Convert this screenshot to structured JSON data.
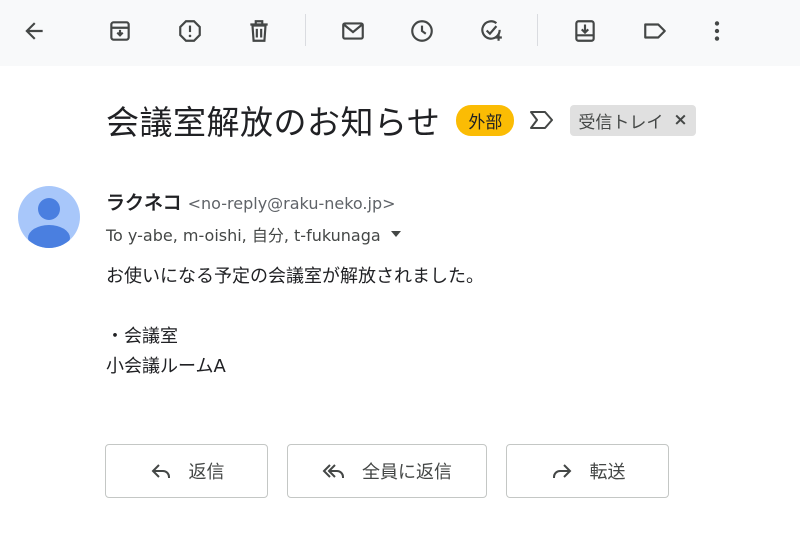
{
  "toolbar": {
    "icons": [
      "back-icon",
      "archive-icon",
      "report-spam-icon",
      "delete-icon",
      "mark-unread-icon",
      "snooze-icon",
      "add-to-tasks-icon",
      "move-to-icon",
      "labels-icon",
      "more-icon"
    ]
  },
  "subject": {
    "text": "会議室解放のお知らせ",
    "external_badge": "外部",
    "label_chip": "受信トレイ",
    "label_chip_remove": "×"
  },
  "message": {
    "sender_name": "ラクネコ",
    "sender_email": "<no-reply@raku-neko.jp>",
    "recipients": "To y-abe, m-oishi, 自分, t-fukunaga",
    "body": {
      "line1": "お使いになる予定の会議室が解放されました。",
      "line2": "・会議室",
      "line3": "小会議ルームA"
    }
  },
  "actions": {
    "reply": "返信",
    "reply_all": "全員に返信",
    "forward": "転送"
  },
  "colors": {
    "external_badge": "#fbbc04",
    "avatar_bg": "#a8c7fa",
    "avatar_fg": "#4a7fe0"
  }
}
